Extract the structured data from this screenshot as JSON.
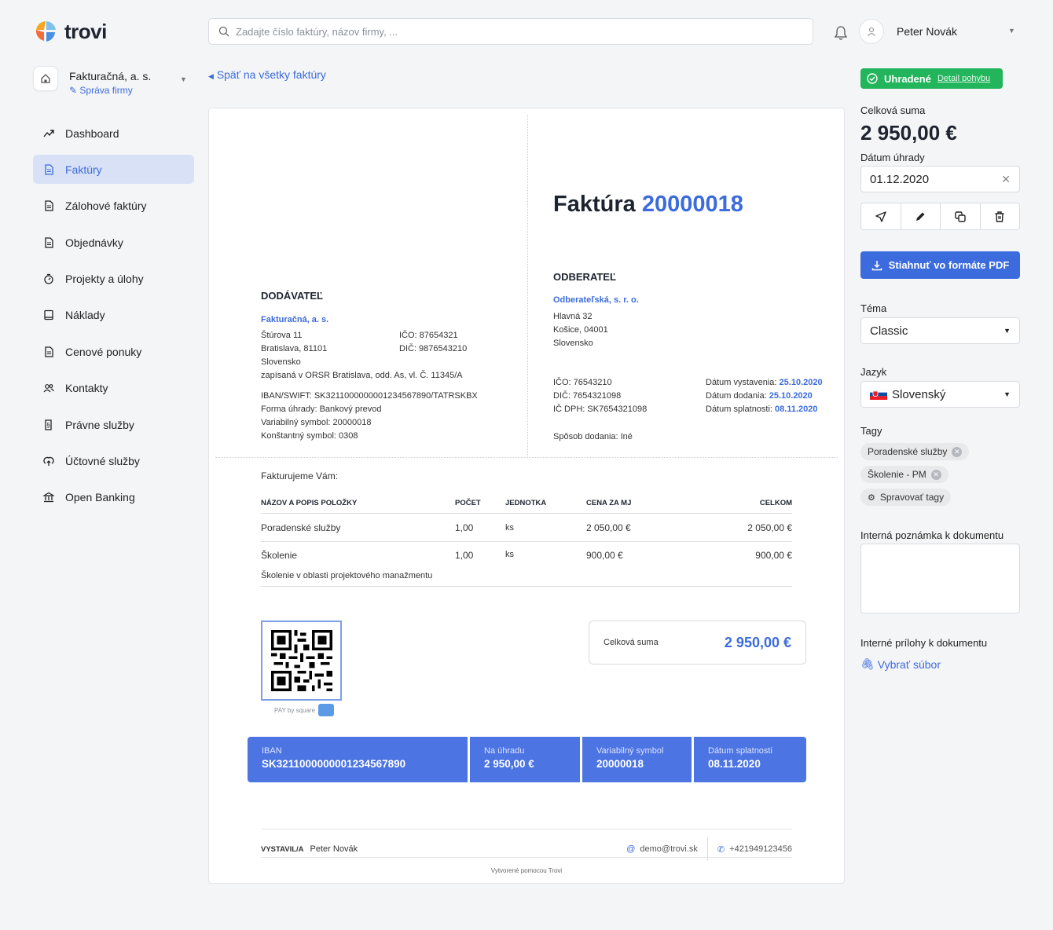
{
  "app": {
    "name": "trovi"
  },
  "search": {
    "placeholder": "Zadajte číslo faktúry, názov firmy, ..."
  },
  "user": {
    "name": "Peter Novák"
  },
  "company": {
    "name": "Fakturačná, a. s.",
    "manage": "Správa firmy"
  },
  "nav": [
    {
      "label": "Dashboard",
      "icon": "trend-icon"
    },
    {
      "label": "Faktúry",
      "icon": "document-icon"
    },
    {
      "label": "Zálohové faktúry",
      "icon": "document-icon"
    },
    {
      "label": "Objednávky",
      "icon": "document-icon"
    },
    {
      "label": "Projekty a úlohy",
      "icon": "timer-icon"
    },
    {
      "label": "Náklady",
      "icon": "tablet-icon"
    },
    {
      "label": "Cenové ponuky",
      "icon": "document-icon"
    },
    {
      "label": "Kontakty",
      "icon": "users-icon"
    },
    {
      "label": "Právne služby",
      "icon": "legal-icon"
    },
    {
      "label": "Účtovné služby",
      "icon": "upload-icon"
    },
    {
      "label": "Open Banking",
      "icon": "bank-icon"
    }
  ],
  "back": "Späť na všetky faktúry",
  "invoice": {
    "title_word": "Faktúra",
    "number": "20000018",
    "supplier_heading": "DODÁVATEĽ",
    "supplier_name": "Fakturačná, a. s.",
    "supplier_street": "Štúrova 11",
    "supplier_city": "Bratislava, 81101",
    "supplier_country": "Slovensko",
    "supplier_register": "zapísaná v ORSR Bratislava, odd. As, vl. Č. 11345/A",
    "supplier_ico": "IČO: 87654321",
    "supplier_dic": "DIČ: 9876543210",
    "iban_line": "IBAN/SWIFT: SK3211000000001234567890/TATRSKBX",
    "payment_form": "Forma úhrady: Bankový prevod",
    "variable_symbol": "Variabilný symbol: 20000018",
    "constant_symbol": "Konštantný symbol: 0308",
    "customer_heading": "ODBERATEĽ",
    "customer_name": "Odberateľská, s. r. o.",
    "customer_street": "Hlavná 32",
    "customer_city": "Košice, 04001",
    "customer_country": "Slovensko",
    "customer_ico": "IČO: 76543210",
    "customer_dic": "DIČ: 7654321098",
    "customer_icdph": "IČ DPH: SK7654321098",
    "issue_label": "Dátum vystavenia:",
    "issue_date": "25.10.2020",
    "delivery_label": "Dátum dodania:",
    "delivery_date": "25.10.2020",
    "due_label": "Dátum splatnosti:",
    "due_date": "08.11.2020",
    "delivery_method": "Spôsob dodania: Iné",
    "intro": "Fakturujeme Vám:",
    "columns": [
      "NÁZOV A POPIS POLOŽKY",
      "POČET",
      "JEDNOTKA",
      "CENA ZA MJ",
      "CELKOM"
    ],
    "items": [
      {
        "name": "Poradenské služby",
        "desc": "",
        "qty": "1,00",
        "unit": "ks",
        "price": "2 050,00 €",
        "total": "2 050,00 €"
      },
      {
        "name": "Školenie",
        "desc": "Školenie v oblasti projektového manažmentu",
        "qty": "1,00",
        "unit": "ks",
        "price": "900,00 €",
        "total": "900,00 €"
      }
    ],
    "paybysquare": "PAY by square",
    "total_label": "Celková suma",
    "total_value": "2 950,00 €",
    "paybar": [
      {
        "label": "IBAN",
        "value": "SK3211000000001234567890"
      },
      {
        "label": "Na úhradu",
        "value": "2 950,00 €"
      },
      {
        "label": "Variabilný symbol",
        "value": "20000018"
      },
      {
        "label": "Dátum splatnosti",
        "value": "08.11.2020"
      }
    ],
    "issued_by_label": "VYSTAVIL/A",
    "issued_by": "Peter Novák",
    "email": "demo@trovi.sk",
    "phone": "+421949123456",
    "created_with": "Vytvorené pomocou Trovi"
  },
  "panel": {
    "status": "Uhradené",
    "status_link": "Detail pohybu",
    "total_label": "Celková suma",
    "total_value": "2 950,00 €",
    "paid_date_label": "Dátum úhrady",
    "paid_date": "01.12.2020",
    "pdf_button": "Stiahnuť vo formáte PDF",
    "theme_label": "Téma",
    "theme_value": "Classic",
    "language_label": "Jazyk",
    "language_value": "Slovenský",
    "tags_label": "Tagy",
    "tags": [
      "Poradenské služby",
      "Školenie - PM"
    ],
    "manage_tags": "Spravovať tagy",
    "note_label": "Interná poznámka k dokumentu",
    "attachments_label": "Interné prílohy k dokumentu",
    "choose_file": "Vybrať súbor"
  },
  "colors": {
    "accent": "#3b6bdc",
    "success": "#22b55b",
    "paybar": "#4c74e3"
  }
}
